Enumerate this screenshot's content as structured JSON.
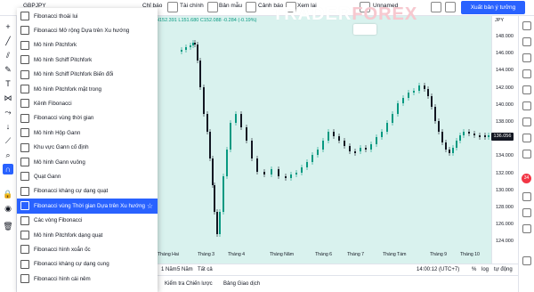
{
  "toolbar": {
    "symbol": "GBPJPY",
    "items": [
      "Chỉ báo",
      "Tài chính",
      "Bản mẫu",
      "Cảnh báo",
      "Xem lại"
    ],
    "layout_name": "Unnamed",
    "publish_label": "Xuất bản ý tưởng"
  },
  "ohlc_text": "H152.391  L151.680  C152.088  -0.284 (-0.19%)",
  "watermark": {
    "part1": "TRADER",
    "part2": "FOREX"
  },
  "left_toolbar": {
    "icons": [
      "crosshair-icon",
      "trend-line-icon",
      "pitchfork-icon",
      "brush-icon",
      "text-icon",
      "pattern-icon",
      "prediction-icon",
      "arrow-down-icon",
      "measure-icon",
      "zoom-icon",
      "magnet-icon",
      "lock-icon",
      "eye-icon",
      "trash-icon"
    ]
  },
  "menu": {
    "items": [
      "Fibonacci thoái lui",
      "Fibonacci Mở rộng Dựa trên Xu hướng",
      "Mô hình Pitchfork",
      "Mô hình Schiff Pitchfork",
      "Mô hình Schiff Pitchfork Biến đổi",
      "Mô hình Pitchfork mặt trong",
      "Kênh Fibonacci",
      "Fibonacci vùng thời gian",
      "Mô hình Hộp Gann",
      "Khu vực Gann cố định",
      "Mô hình Gann vuông",
      "Quạt Gann",
      "Fibonacci kháng cự dạng quạt",
      "Fibonacci vùng Thời gian Dựa trên Xu hướng",
      "Các vòng Fibonacci",
      "Mô hình Pitchfork dạng quạt",
      "Fibonacci hình xoắn ốc",
      "Fibonacci kháng cự dạng cung",
      "Fibonacci hình cái nêm"
    ],
    "highlighted_index": 13
  },
  "price_axis": {
    "currency": "JPY",
    "labels": [
      "148.000",
      "146.000",
      "144.000",
      "142.000",
      "140.000",
      "138.000",
      "136.000",
      "134.000",
      "132.000",
      "130.000",
      "128.000",
      "126.000",
      "124.000"
    ],
    "current_price": "136.056"
  },
  "time_axis": {
    "labels": [
      "Tháng Hai",
      "Tháng 3",
      "Tháng 4",
      "Tháng Năm",
      "Tháng 6",
      "Tháng 7",
      "Tháng Tám",
      "Tháng 9",
      "Tháng 10"
    ]
  },
  "bottom_bar": {
    "ranges": [
      "1 Năm",
      "5 Năm",
      "Tất cả"
    ],
    "time": "14:00:12 (UTC+7)",
    "pct": "%",
    "log": "log",
    "auto": "tự động"
  },
  "footer": {
    "tabs": [
      "Kiểm tra Chiến lược",
      "Bảng Giao dịch"
    ]
  },
  "right_toolbar": {
    "badge": "34"
  },
  "colors": {
    "chart_bg": "#d9f2ee",
    "accent": "#2962ff",
    "up": "#089981",
    "down": "#131722"
  }
}
